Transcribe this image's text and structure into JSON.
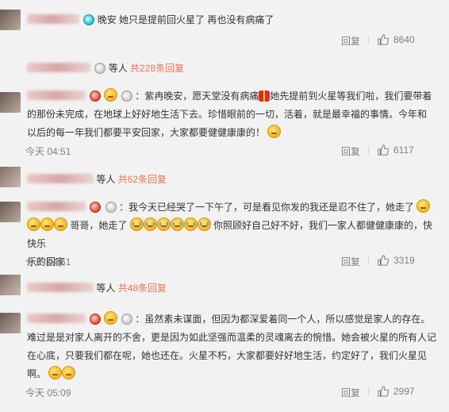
{
  "top_comment": {
    "text": "晚安 她只是提前回火星了 再也没有病痛了",
    "reply_label": "回复",
    "likes": "8640"
  },
  "sub_thread_1": {
    "more_label": "等人",
    "count_label": "共228条回复"
  },
  "comment_1": {
    "line1": "：紫冉晚安，愿天堂没有病痛",
    "line1b": "她先提前到火星等我们啦，我们要带着",
    "line2": "的那份未完成，在地球上好好地生活下去。珍惜眼前的一切，活着，就是最幸福的事情。今年和",
    "line3": "以后的每一年我们都要平安回家，大家都要健健康康的！",
    "time": "今天 04:51",
    "reply_label": "回复",
    "likes": "6117"
  },
  "sub_thread_2": {
    "more_label": "等人",
    "count_label": "共62条回复"
  },
  "comment_2": {
    "line1": "：我今天已经哭了一下午了，可是看见你发的我还是忍不住了，她走了",
    "line2a": "哥哥，她走了",
    "line2b": "你照顾好自己好不好，我们一家人都健健康康的，快快乐",
    "line3": "乐的回家",
    "time": "今天 04:51",
    "reply_label": "回复",
    "likes": "3319"
  },
  "sub_thread_3": {
    "more_label": "等人",
    "count_label": "共48条回复"
  },
  "comment_3": {
    "line1": "：虽然素未谋面，但因为都深爱着同一个人，所以感觉是家人的存在。",
    "line2": "难过是是对家人离开的不舍，更是因为如此坚强而温柔的灵魂离去的惋惜。她会被火星的所有人记",
    "line3": "在心底，只要我们都在呢，她也还在。火星不朽，大家都要好好地生活，约定好了，我们火星见",
    "line4": "啊。",
    "time": "今天 05:09",
    "reply_label": "回复",
    "likes": "2997"
  },
  "icons": {
    "like": "thumbs-up-icon",
    "gift": "gift-icon",
    "emoji": "face-emoji-icon",
    "cry": "crying-face-icon",
    "badge": "user-badge-icon"
  },
  "colors": {
    "background": "#f2f2f2",
    "link": "#eb7350",
    "meta": "#808080"
  }
}
